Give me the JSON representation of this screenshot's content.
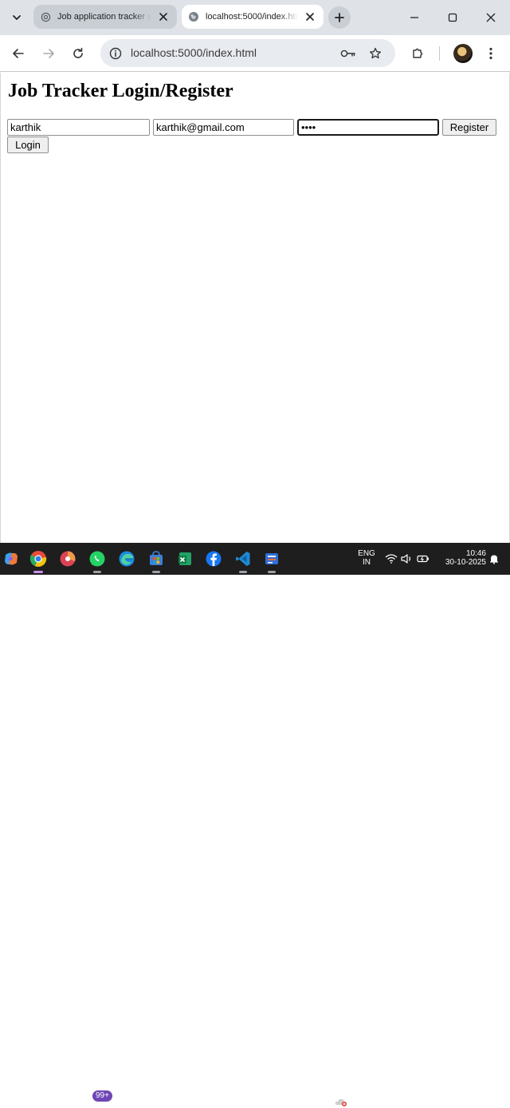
{
  "browser": {
    "tabs": [
      {
        "title": "Job application tracker s",
        "active": false
      },
      {
        "title": "localhost:5000/index.htm",
        "active": true
      }
    ],
    "url": "localhost:5000/index.html"
  },
  "page": {
    "heading": "Job Tracker Login/Register",
    "fields": {
      "username": {
        "value": "karthik"
      },
      "email": {
        "value": "karthik@gmail.com"
      },
      "password": {
        "value": "1234",
        "type": "password"
      }
    },
    "buttons": {
      "register": "Register",
      "login": "Login"
    }
  },
  "taskbar": {
    "whatsapp_badge": "99+",
    "language": {
      "line1": "ENG",
      "line2": "IN"
    },
    "clock": {
      "time": "10:46",
      "date": "30-10-2025"
    }
  },
  "colors": {
    "tabstrip": "#dfe3e8",
    "taskbar": "#1e1e1e",
    "omnibox": "#e8ebef"
  }
}
